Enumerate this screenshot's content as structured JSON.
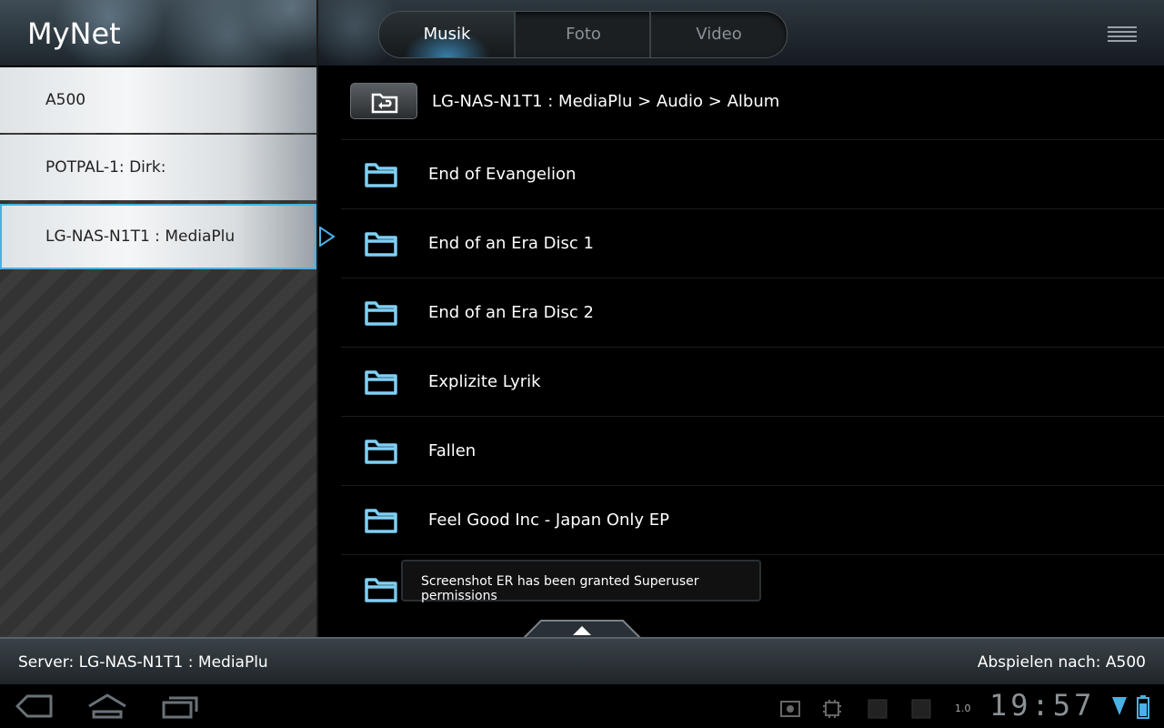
{
  "app": {
    "title": "MyNet"
  },
  "colors": {
    "accent": "#4ab0e6",
    "folder": "#7fd0f5"
  },
  "tabs": [
    {
      "label": "Musik",
      "active": true
    },
    {
      "label": "Foto",
      "active": false
    },
    {
      "label": "Video",
      "active": false
    }
  ],
  "servers": [
    {
      "label": "A500",
      "selected": false
    },
    {
      "label": "POTPAL-1: Dirk:",
      "selected": false
    },
    {
      "label": "LG-NAS-N1T1 : MediaPlu",
      "selected": true
    }
  ],
  "breadcrumb": "LG-NAS-N1T1 : MediaPlu > Audio > Album",
  "folders": [
    "End of Evangelion",
    "End of an Era Disc 1",
    "End of an Era Disc 2",
    "Explizite Lyrik",
    "Fallen",
    "Feel Good Inc - Japan Only EP",
    ""
  ],
  "toast": "Screenshot ER has been granted Superuser permissions",
  "status": {
    "server": "Server: LG-NAS-N1T1 : MediaPlu",
    "play_target": "Abspielen nach: A500"
  },
  "system": {
    "version": "1.0",
    "clock": "19:57"
  }
}
